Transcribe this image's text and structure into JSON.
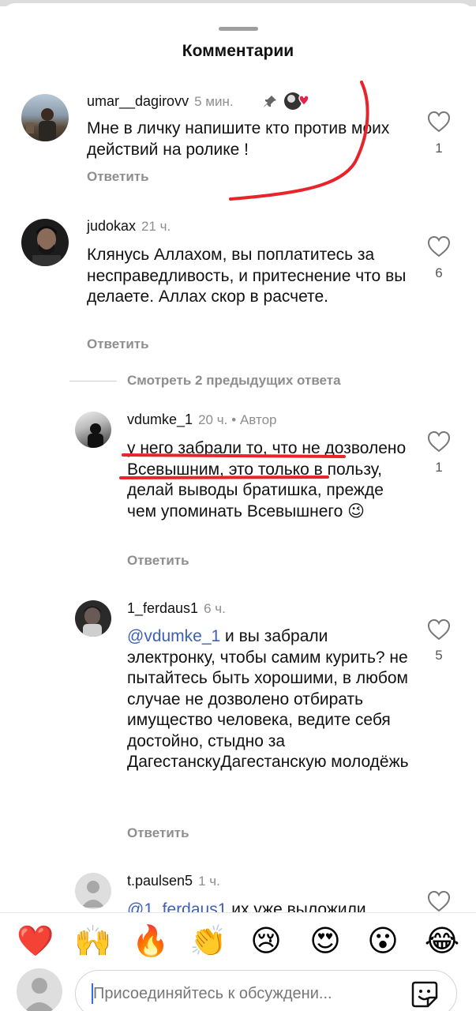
{
  "header": {
    "title": "Комментарии"
  },
  "comments": [
    {
      "username": "umar__dagirovv",
      "time": "5 мин.",
      "text": "Мне в личку напишите кто против моих действий на ролике !",
      "reply_label": "Ответить",
      "likes": "1"
    },
    {
      "username": "judokax",
      "time": "21 ч.",
      "text": "Клянусь Аллахом, вы поплатитесь за несправедливость, и притеснение что вы делаете. Аллах скор в расчете.",
      "reply_label": "Ответить",
      "likes": "6"
    },
    {
      "username": "vdumke_1",
      "time": "20 ч.",
      "author_label": "• Автор",
      "text": "у него забрали то, что не дозволено Всевышним, это только в пользу, делай выводы братишка, прежде чем упоминать Всевышнего 😉",
      "reply_label": "Ответить",
      "likes": "1"
    },
    {
      "username": "1_ferdaus1",
      "time": "6 ч.",
      "mention": "@vdumke_1",
      "text": " и вы забрали электронку, чтобы самим курить? не пытайтесь быть хорошими, в любом случае не дозволено отбирать имущество человека, ведите себя достойно, стыдно за ДагестанскуДагестанскую молодёжь",
      "reply_label": "Ответить",
      "likes": "5"
    },
    {
      "username": "t.paulsen5",
      "time": "1 ч.",
      "mention": "@1_ferdaus1",
      "text": " их уже выложили"
    }
  ],
  "view_replies": "Смотреть 2 предыдущих ответа",
  "reactions": [
    "❤️",
    "🙌",
    "🔥",
    "👏",
    "😢",
    "😍",
    "😮",
    "😂"
  ],
  "composer": {
    "placeholder": "Присоединяйтесь к обсуждени..."
  }
}
